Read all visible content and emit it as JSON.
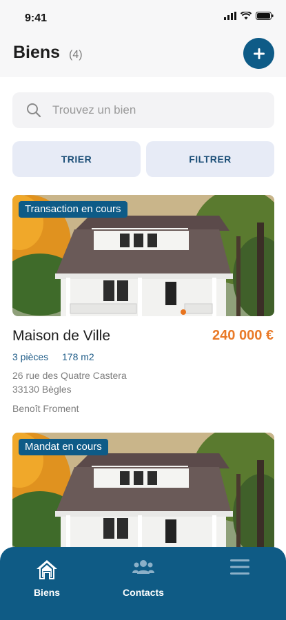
{
  "status_bar": {
    "time": "9:41"
  },
  "header": {
    "title": "Biens",
    "count": "(4)"
  },
  "search": {
    "placeholder": "Trouvez un bien"
  },
  "actions": {
    "sort_label": "TRIER",
    "filter_label": "FILTRER"
  },
  "properties": [
    {
      "status": "Transaction en cours",
      "title": "Maison de Ville",
      "price": "240 000 €",
      "rooms": "3 pièces",
      "area": "178 m2",
      "address_line1": "26 rue des Quatre Castera",
      "address_line2": "33130 Bègles",
      "agent": "Benoît Froment"
    },
    {
      "status": "Mandat en cours"
    }
  ],
  "nav": {
    "items": [
      {
        "label": "Biens",
        "icon": "home-icon"
      },
      {
        "label": "Contacts",
        "icon": "people-icon"
      },
      {
        "label": "",
        "icon": "menu-icon"
      }
    ]
  },
  "colors": {
    "primary": "#0e5b87",
    "accent": "#e97a28",
    "button_bg": "#e7ebf6"
  }
}
